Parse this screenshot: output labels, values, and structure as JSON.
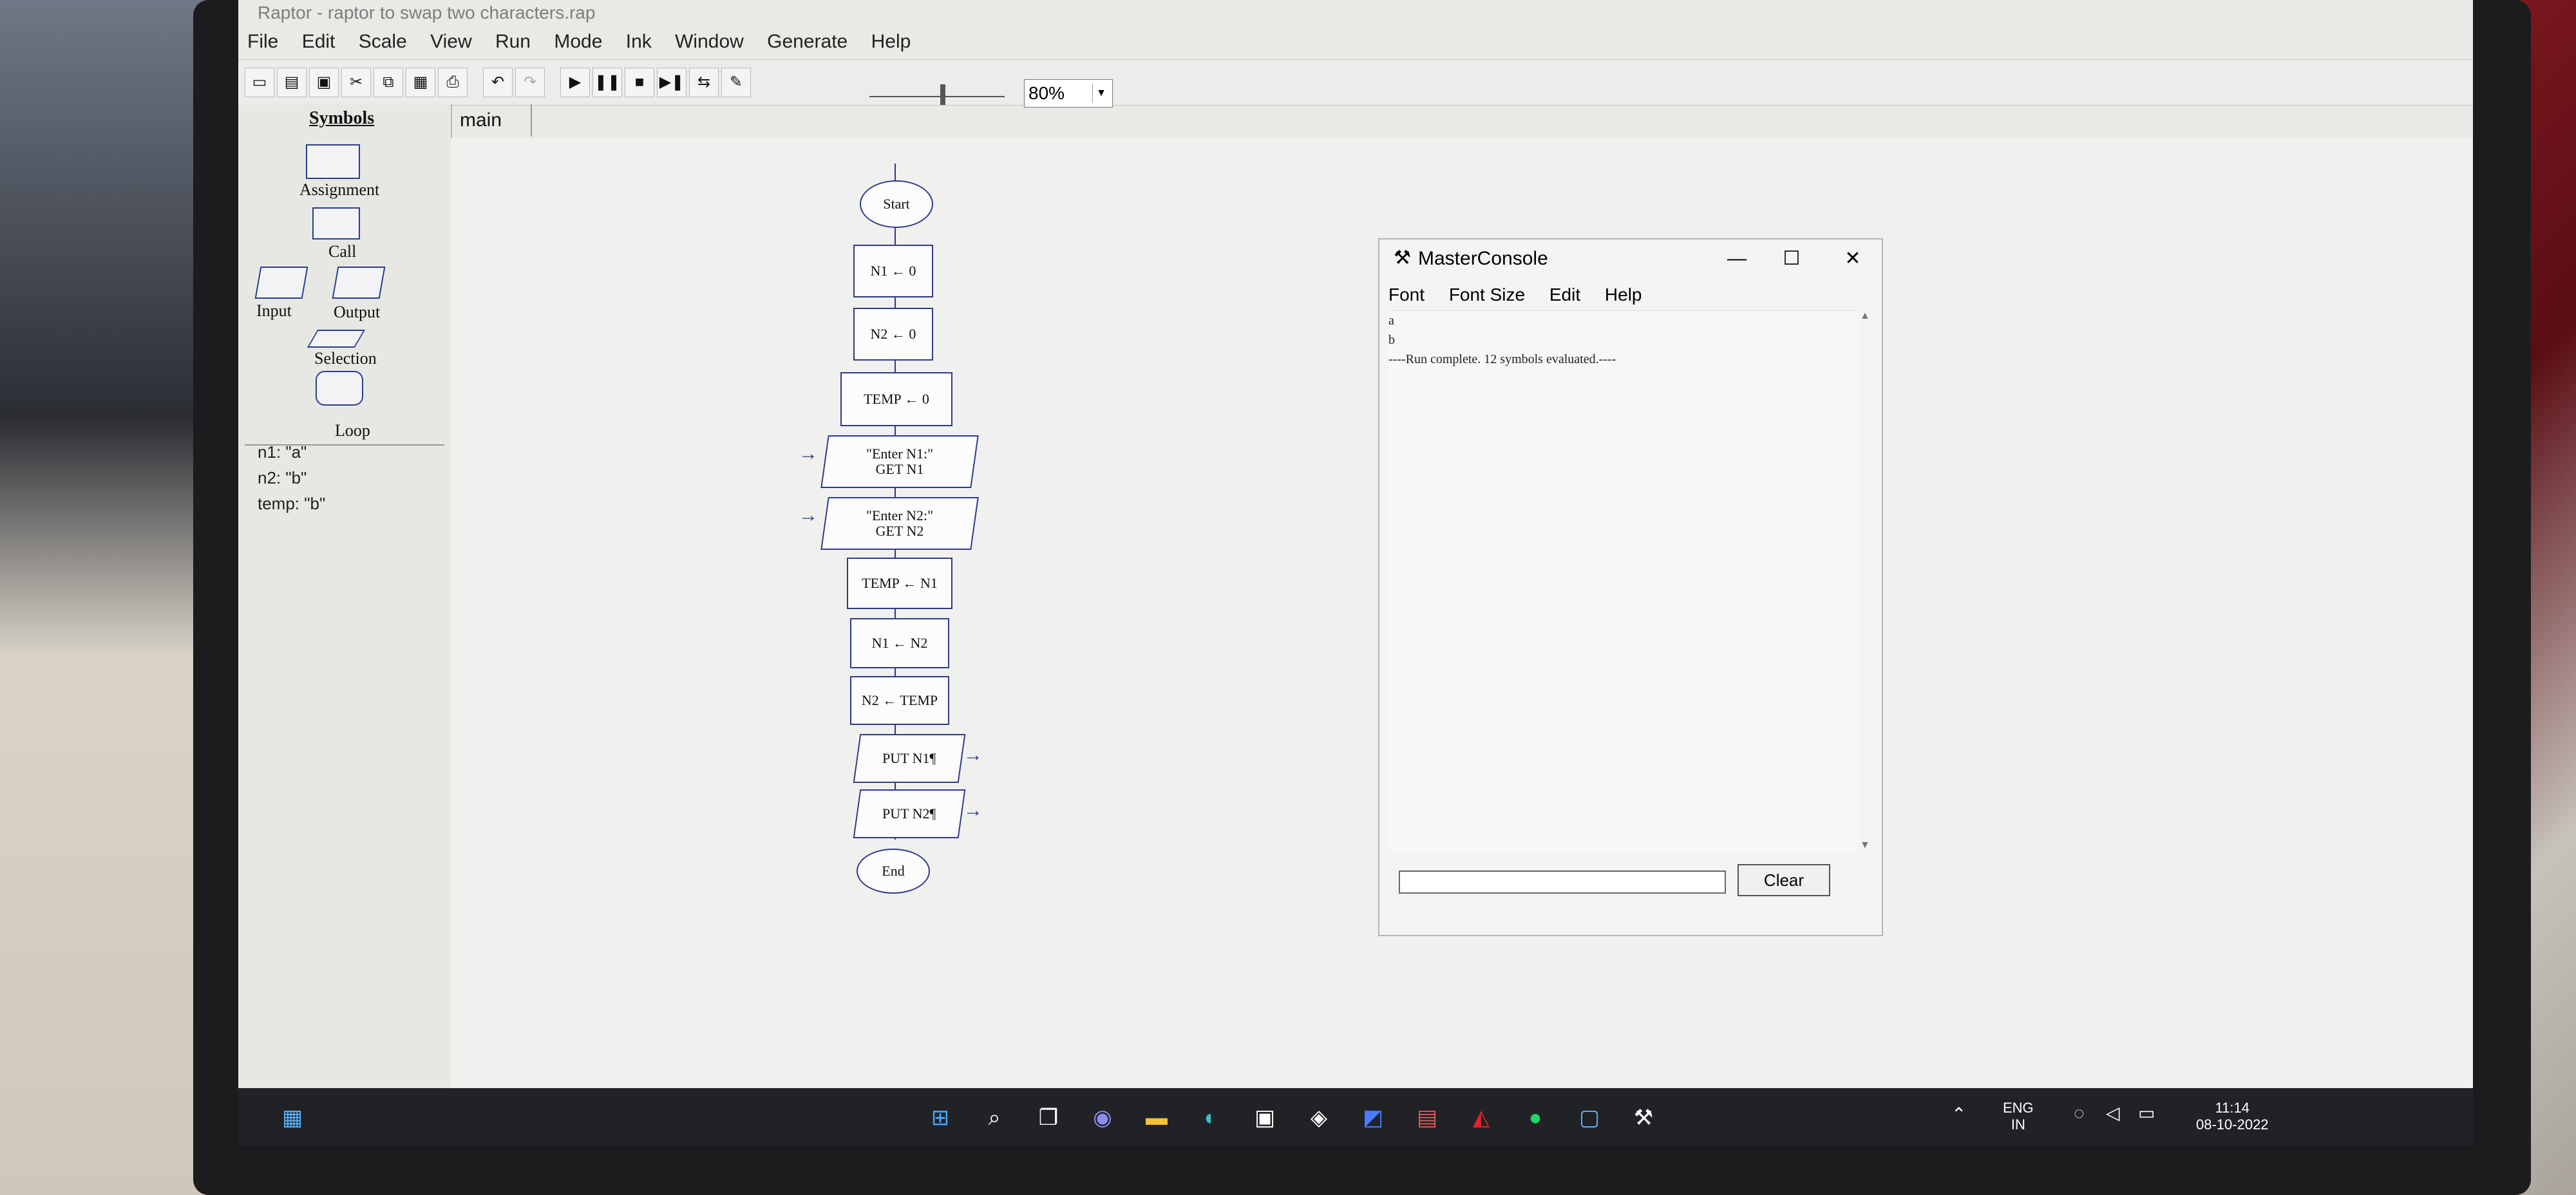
{
  "window": {
    "title": "Raptor - raptor to swap two characters.rap",
    "menu": [
      "File",
      "Edit",
      "Scale",
      "View",
      "Run",
      "Mode",
      "Ink",
      "Window",
      "Generate",
      "Help"
    ]
  },
  "toolbar": {
    "zoom_value": "80%",
    "icons": [
      "new-icon",
      "open-icon",
      "save-icon",
      "cut-icon",
      "copy-icon",
      "paste-icon",
      "print-icon",
      "undo-icon",
      "redo-icon",
      "run-icon",
      "pause-icon",
      "stop-icon",
      "step-icon",
      "test-server-icon",
      "ink-pen-icon"
    ]
  },
  "symbols": {
    "title": "Symbols",
    "items": [
      "Assignment",
      "Call",
      "Input",
      "Output",
      "Selection",
      "Loop"
    ]
  },
  "variables": [
    "n1: \"a\"",
    "n2: \"b\"",
    "temp: \"b\""
  ],
  "tab": "main",
  "flowchart": {
    "start": "Start",
    "a1": "N1 ← 0",
    "a2": "N2 ← 0",
    "a3": "TEMP ← 0",
    "in1_prompt": "\"Enter N1:\"",
    "in1_get": "GET N1",
    "in2_prompt": "\"Enter N2:\"",
    "in2_get": "GET N2",
    "a4": "TEMP ← N1",
    "a5": "N1 ← N2",
    "a6": "N2 ← TEMP",
    "out1": "PUT N1¶",
    "out2": "PUT N2¶",
    "end": "End"
  },
  "console": {
    "title": "MasterConsole",
    "menu": [
      "Font",
      "Font Size",
      "Edit",
      "Help"
    ],
    "lines": [
      "a",
      "b",
      "----Run complete.  12 symbols evaluated.----"
    ],
    "clear_label": "Clear",
    "input_value": ""
  },
  "taskbar": {
    "icons": [
      "windows-start-icon",
      "search-icon",
      "task-view-icon",
      "teams-chat-icon",
      "file-explorer-icon",
      "edge-browser-icon",
      "store-icon",
      "app-icon",
      "app-icon",
      "app-icon",
      "mcafee-icon",
      "spotify-icon",
      "app-icon",
      "raptor-icon"
    ],
    "lang_top": "ENG",
    "lang_bottom": "IN",
    "time": "11:14",
    "date": "08-10-2022"
  }
}
